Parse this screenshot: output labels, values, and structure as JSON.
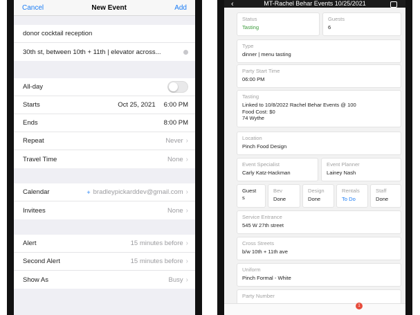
{
  "left": {
    "nav": {
      "cancel": "Cancel",
      "title": "New Event",
      "add": "Add"
    },
    "title_field": "donor cocktail reception",
    "location_field": "30th st, between 10th + 11th | elevator across...",
    "all_day_label": "All-day",
    "starts": {
      "label": "Starts",
      "date": "Oct 25, 2021",
      "time": "6:00 PM"
    },
    "ends": {
      "label": "Ends",
      "time": "8:00 PM"
    },
    "repeat": {
      "label": "Repeat",
      "value": "Never"
    },
    "travel": {
      "label": "Travel Time",
      "value": "None"
    },
    "calendar": {
      "label": "Calendar",
      "value": "bradleypickarddev@gmail.com"
    },
    "invitees": {
      "label": "Invitees",
      "value": "None"
    },
    "alert": {
      "label": "Alert",
      "value": "15 minutes before"
    },
    "second_alert": {
      "label": "Second Alert",
      "value": "15 minutes before"
    },
    "show_as": {
      "label": "Show As",
      "value": "Busy"
    }
  },
  "right": {
    "header_title": "MT-Rachel Behar Events 10/25/2021",
    "status": {
      "label": "Status",
      "value": "Tasting"
    },
    "guests": {
      "label": "Guests",
      "value": "6"
    },
    "type": {
      "label": "Type",
      "value": "dinner | menu tasting"
    },
    "party_start": {
      "label": "Party Start Time",
      "value": "06:00 PM"
    },
    "tasting": {
      "label": "Tasting",
      "line1": "Linked to 10/8/2022 Rachel Behar Events @ 100",
      "line2": "Food Cost: $0",
      "line3": "74 Wythe"
    },
    "location": {
      "label": "Location",
      "value": "Pinch Food Design"
    },
    "event_specialist": {
      "label": "Event Specialist",
      "value": "Carly Katz-Hackman"
    },
    "event_planner": {
      "label": "Event Planner",
      "value": "Lainey Nash"
    },
    "guest_box": {
      "label": "Guest",
      "value": "s"
    },
    "bev": {
      "label": "Bev",
      "value": "Done"
    },
    "design": {
      "label": "Design",
      "value": "Done"
    },
    "rentals": {
      "label": "Rentals",
      "value": "To Do"
    },
    "staff": {
      "label": "Staff",
      "value": "Done"
    },
    "service_entrance": {
      "label": "Service Entrance",
      "value": "545 W 27th street"
    },
    "cross_streets": {
      "label": "Cross Streets",
      "value": "b/w 10th + 11th ave"
    },
    "uniform": {
      "label": "Uniform",
      "value": "Pinch Formal - White"
    },
    "party_number": {
      "label": "Party Number"
    },
    "notification_count": "1"
  },
  "colors": {
    "ios_blue": "#1a7cf5",
    "status_green": "#3a9a3a",
    "badge_red": "#e74c3c"
  }
}
